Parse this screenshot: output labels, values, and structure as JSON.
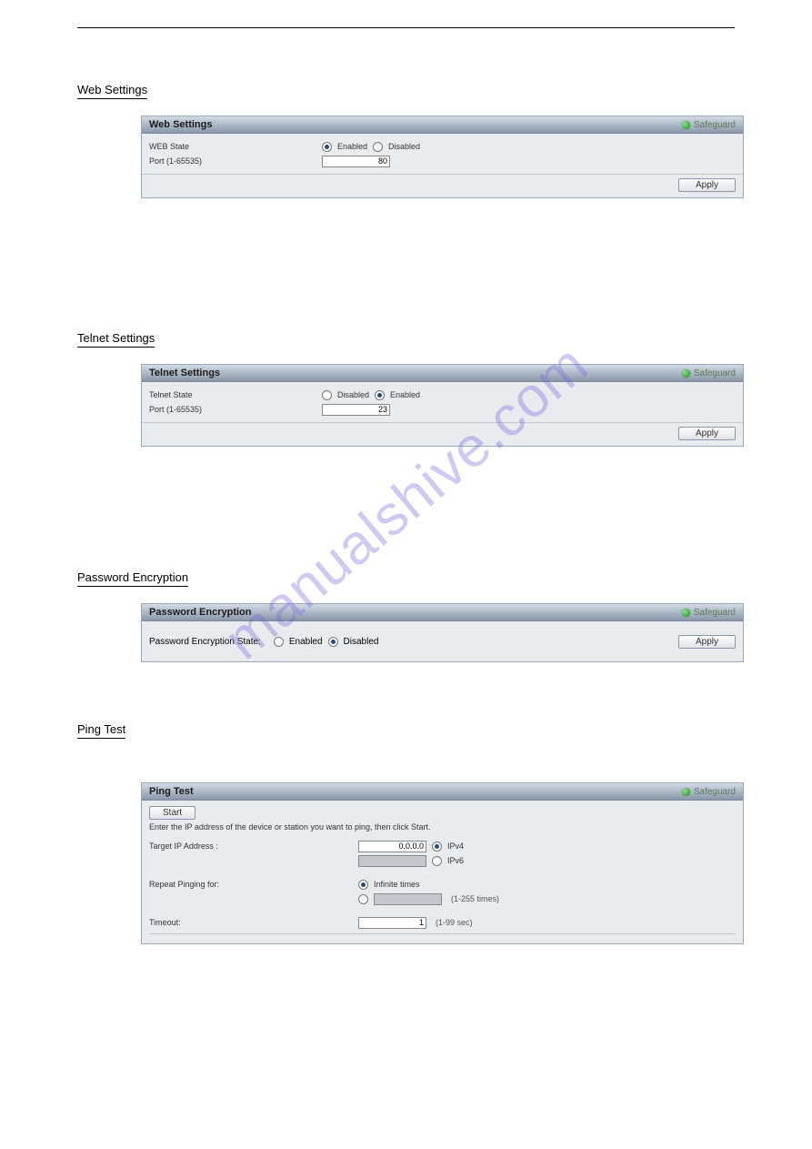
{
  "watermark": "manualshive.com",
  "sections": {
    "web": {
      "heading": "Web Settings",
      "panel_title": "Web Settings",
      "safeguard": "Safeguard",
      "state_label": "WEB State",
      "port_label": "Port (1-65535)",
      "enabled": "Enabled",
      "disabled": "Disabled",
      "port_value": "80",
      "apply": "Apply"
    },
    "telnet": {
      "heading": "Telnet Settings",
      "panel_title": "Telnet Settings",
      "safeguard": "Safeguard",
      "state_label": "Telnet State",
      "port_label": "Port (1-65535)",
      "enabled": "Enabled",
      "disabled": "Disabled",
      "port_value": "23",
      "apply": "Apply"
    },
    "pwd": {
      "heading": "Password Encryption",
      "panel_title": "Password Encryption",
      "safeguard": "Safeguard",
      "state_label": "Password Encryption State:",
      "enabled": "Enabled",
      "disabled": "Disabled",
      "apply": "Apply"
    },
    "ping": {
      "heading": "Ping Test",
      "panel_title": "Ping Test",
      "safeguard": "Safeguard",
      "start": "Start",
      "instruction": "Enter the IP address of the device or station you want to ping, then click Start.",
      "target_label": "Target IP Address :",
      "target_value": "0.0.0.0",
      "ipv4": "IPv4",
      "ipv6": "IPv6",
      "repeat_label": "Repeat Pinging for:",
      "infinite": "Infinite times",
      "count_hint": "(1-255 times)",
      "timeout_label": "Timeout:",
      "timeout_value": "1",
      "timeout_hint": "(1-99 sec)"
    }
  }
}
